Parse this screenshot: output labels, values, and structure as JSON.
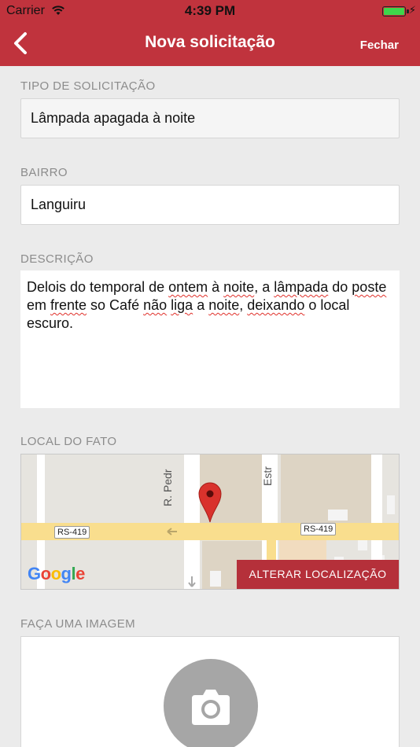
{
  "status": {
    "carrier": "Carrier",
    "time": "4:39 PM"
  },
  "nav": {
    "title": "Nova solicitação",
    "close_label": "Fechar"
  },
  "form": {
    "type_label": "TIPO DE SOLICITAÇÃO",
    "type_value": "Lâmpada apagada à noite",
    "district_label": "BAIRRO",
    "district_value": "Languiru",
    "description_label": "DESCRIÇÃO",
    "description_parts": [
      "Delois do temporal de ",
      "ontem",
      " à ",
      "noite",
      ", a ",
      "lâmpada",
      " do ",
      "poste",
      " em ",
      "frente",
      " so Café ",
      "não",
      " ",
      "liga",
      " a ",
      "noite",
      ", ",
      "deixando",
      " o local escuro."
    ],
    "location_label": "LOCAL DO FATO",
    "image_label": "FAÇA UMA IMAGEM"
  },
  "map": {
    "road_label_left": "RS-419",
    "road_label_right": "RS-419",
    "street_1": "R. Pedr",
    "street_2": "Estr",
    "change_location_button": "ALTERAR LOCALIZAÇÃO",
    "logo_text": "Google",
    "colors": {
      "road_main": "#f9de8e",
      "road_minor": "#ffffff",
      "pin": "#d9322c",
      "button": "#b5303a"
    }
  },
  "colors": {
    "brand": "#c0333d",
    "background": "#ebebeb",
    "label": "#8c8c8c"
  },
  "icons": {
    "back": "chevron-left-icon",
    "camera": "camera-icon",
    "wifi": "wifi-icon",
    "battery": "battery-icon",
    "pin": "map-pin-icon"
  }
}
